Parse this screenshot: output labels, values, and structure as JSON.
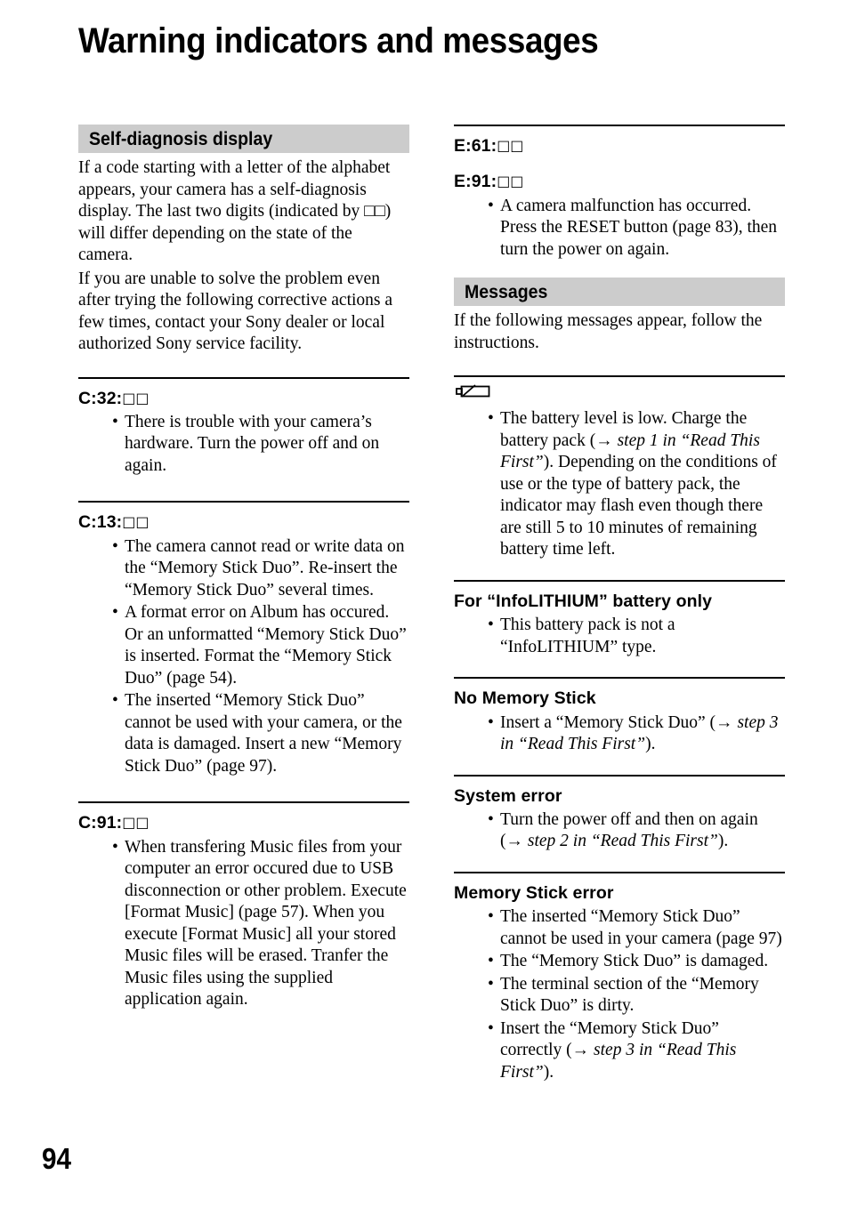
{
  "document": {
    "title": "Warning indicators and messages",
    "page_number": "94"
  },
  "left_column": {
    "section": {
      "heading": "Self-diagnosis display",
      "intro_paragraph_1": "If a code starting with a letter of the alphabet appears, your camera has a self-diagnosis display. The last two digits (indicated by □□) will differ depending on the state of the camera.",
      "intro_paragraph_2": "If you are unable to solve the problem even after trying the following corrective actions a few times, contact your Sony dealer or local authorized Sony service facility."
    },
    "entries": [
      {
        "code_prefix": "C:32:",
        "code_boxes": "□□",
        "bullets": [
          "There is trouble with your camera’s hardware. Turn the power off and on again."
        ]
      },
      {
        "code_prefix": "C:13:",
        "code_boxes": "□□",
        "bullets": [
          "The camera cannot read or write data on the “Memory Stick Duo”. Re-insert the “Memory Stick Duo” several times.",
          "A format error on Album has occured. Or an unformatted “Memory Stick Duo” is inserted. Format the “Memory Stick Duo” (page 54).",
          "The inserted “Memory Stick Duo” cannot be used with your camera, or the data is damaged. Insert a new “Memory Stick Duo” (page 97)."
        ]
      },
      {
        "code_prefix": "C:91:",
        "code_boxes": "□□",
        "bullets": [
          "When transfering Music files from your computer an error occured due to USB disconnection or other problem. Execute [Format Music] (page 57). When you execute [Format Music] all your stored Music files will be erased. Tranfer the Music files using the supplied application again."
        ]
      }
    ]
  },
  "right_column": {
    "error_codes": [
      {
        "code_prefix": "E:61:",
        "code_boxes": "□□"
      },
      {
        "code_prefix": "E:91:",
        "code_boxes": "□□"
      }
    ],
    "error_codes_bullets": [
      "A camera malfunction has occurred. Press the RESET button (page 83), then turn the power on again."
    ],
    "messages_section": {
      "heading": "Messages",
      "intro": "If the following messages appear, follow the instructions."
    },
    "messages": [
      {
        "icon": "low-battery-icon",
        "heading": "",
        "bullets_rich": [
          {
            "pre": "The battery level is low. Charge the battery pack (→ ",
            "italic": "step 1 in “Read This First”",
            "post": "). Depending on the conditions of use or the type of battery pack, the indicator may flash even though there are still 5 to 10 minutes of remaining battery time left."
          }
        ]
      },
      {
        "heading": "For “InfoLITHIUM” battery only",
        "bullets_rich": [
          {
            "pre": "This battery pack is not a “InfoLITHIUM” type.",
            "italic": "",
            "post": ""
          }
        ]
      },
      {
        "heading": "No Memory Stick",
        "bullets_rich": [
          {
            "pre": "Insert a “Memory Stick Duo” (→ ",
            "italic": "step 3 in “Read This First”",
            "post": ")."
          }
        ]
      },
      {
        "heading": "System error",
        "bullets_rich": [
          {
            "pre": "Turn the power off and then on again (→ ",
            "italic": "step 2 in “Read This First”",
            "post": ")."
          }
        ]
      },
      {
        "heading": "Memory Stick error",
        "bullets_rich": [
          {
            "pre": "The inserted “Memory Stick Duo” cannot be used in your camera (page 97)",
            "italic": "",
            "post": ""
          },
          {
            "pre": "The “Memory Stick Duo” is damaged.",
            "italic": "",
            "post": ""
          },
          {
            "pre": "The terminal section of the “Memory Stick Duo” is dirty.",
            "italic": "",
            "post": ""
          },
          {
            "pre": "Insert the “Memory Stick Duo” correctly (→ ",
            "italic": "step 3 in “Read This First”",
            "post": ")."
          }
        ]
      }
    ]
  },
  "colors": {
    "banner_background": "#cccccc",
    "text": "#000000",
    "page_background": "#ffffff",
    "rule": "#000000"
  }
}
